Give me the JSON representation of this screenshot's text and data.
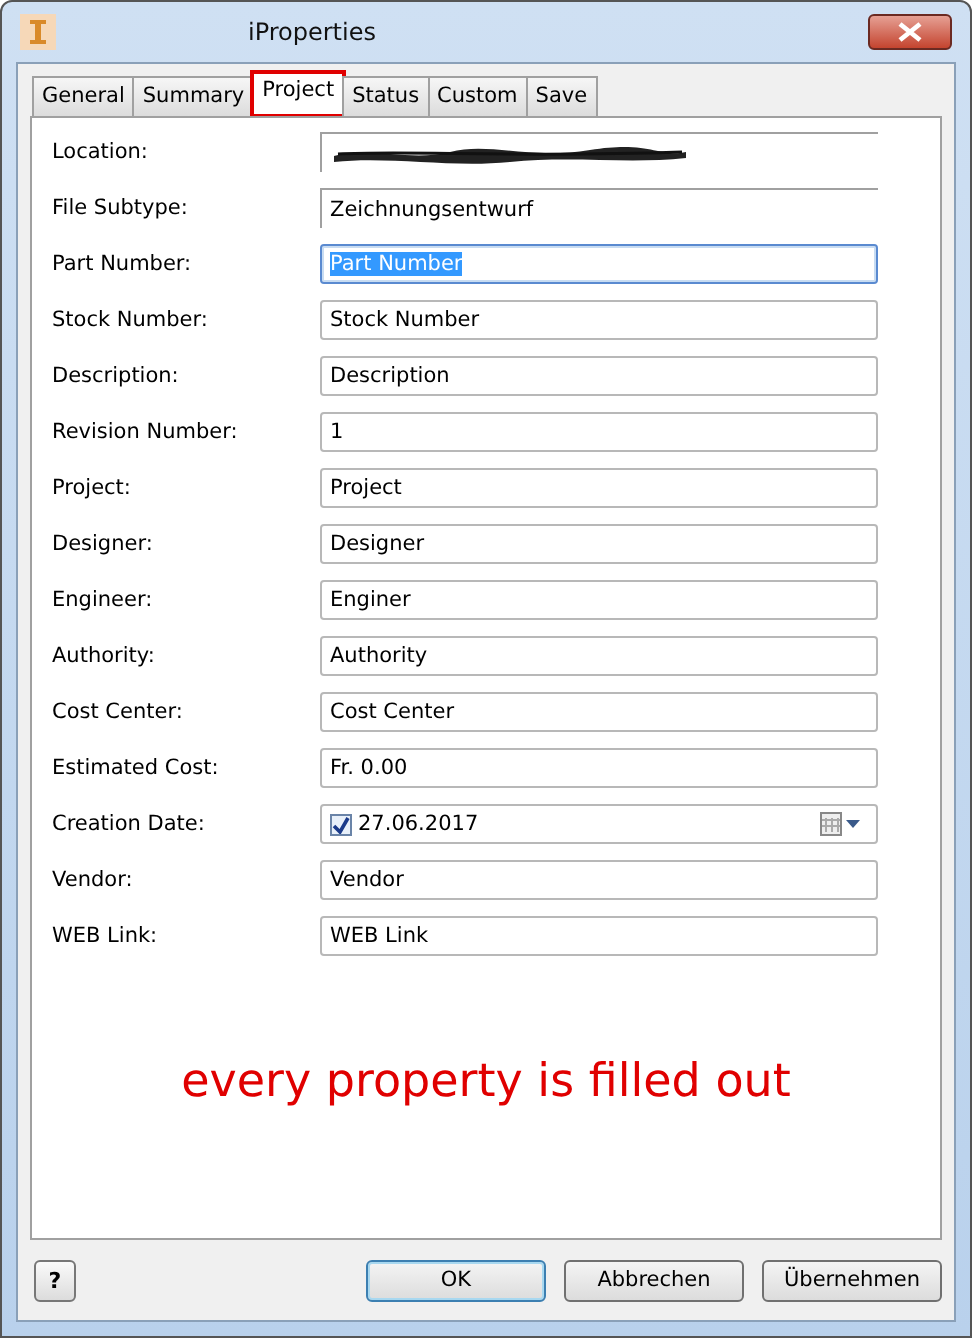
{
  "window": {
    "title": "iProperties"
  },
  "tabs": [
    {
      "label": "General",
      "selected": false,
      "highlighted": false
    },
    {
      "label": "Summary",
      "selected": false,
      "highlighted": false
    },
    {
      "label": "Project",
      "selected": true,
      "highlighted": true
    },
    {
      "label": "Status",
      "selected": false,
      "highlighted": false
    },
    {
      "label": "Custom",
      "selected": false,
      "highlighted": false
    },
    {
      "label": "Save",
      "selected": false,
      "highlighted": false
    }
  ],
  "fields": [
    {
      "label": "Location:",
      "kind": "redacted"
    },
    {
      "label": "File Subtype:",
      "kind": "readonly",
      "value": "Zeichnungsentwurf"
    },
    {
      "label": "Part Number:",
      "kind": "text",
      "value": "Part Number",
      "focused": true
    },
    {
      "label": "Stock Number:",
      "kind": "text",
      "value": "Stock Number",
      "focused": false
    },
    {
      "label": "Description:",
      "kind": "text",
      "value": "Description",
      "focused": false
    },
    {
      "label": "Revision Number:",
      "kind": "text",
      "value": "1",
      "focused": false
    },
    {
      "label": "Project:",
      "kind": "text",
      "value": "Project",
      "focused": false
    },
    {
      "label": "Designer:",
      "kind": "text",
      "value": "Designer",
      "focused": false
    },
    {
      "label": "Engineer:",
      "kind": "text",
      "value": "Enginer",
      "focused": false
    },
    {
      "label": "Authority:",
      "kind": "text",
      "value": "Authority",
      "focused": false
    },
    {
      "label": "Cost Center:",
      "kind": "text",
      "value": "Cost Center",
      "focused": false
    },
    {
      "label": "Estimated Cost:",
      "kind": "text",
      "value": "Fr. 0.00",
      "focused": false
    },
    {
      "label": "Creation Date:",
      "kind": "date",
      "value": "27.06.2017",
      "checked": true,
      "focused": false
    },
    {
      "label": "Vendor:",
      "kind": "text",
      "value": "Vendor",
      "focused": false
    },
    {
      "label": "WEB Link:",
      "kind": "text",
      "value": "WEB Link",
      "focused": false
    }
  ],
  "annotation": "every property is filled out",
  "help": "?",
  "buttons": [
    {
      "label": "OK",
      "default": true
    },
    {
      "label": "Abbrechen",
      "default": false
    },
    {
      "label": "Übernehmen",
      "default": false
    }
  ]
}
